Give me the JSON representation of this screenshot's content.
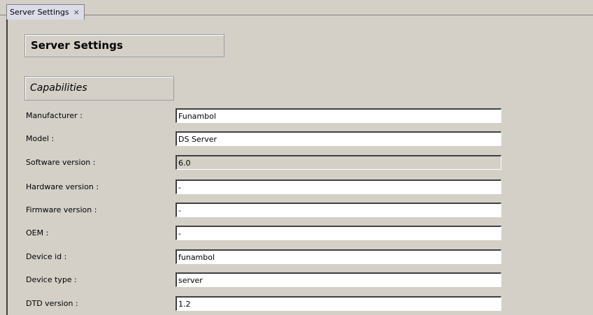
{
  "tab": {
    "label": "Server Settings",
    "close_glyph": "×"
  },
  "page": {
    "title": "Server Settings",
    "section": "Capabilities"
  },
  "fields": [
    {
      "label": "Manufacturer :",
      "value": "Funambol",
      "readonly": false
    },
    {
      "label": "Model :",
      "value": "DS Server",
      "readonly": false
    },
    {
      "label": "Software version :",
      "value": "6.0",
      "readonly": true
    },
    {
      "label": "Hardware version :",
      "value": "-",
      "readonly": false
    },
    {
      "label": "Firmware version :",
      "value": "-",
      "readonly": false
    },
    {
      "label": "OEM :",
      "value": "-",
      "readonly": false
    },
    {
      "label": "Device id :",
      "value": "funambol",
      "readonly": false
    },
    {
      "label": "Device type :",
      "value": "server",
      "readonly": false
    },
    {
      "label": "DTD version :",
      "value": "1.2",
      "readonly": false
    }
  ],
  "colors": {
    "background": "#d4d0c8",
    "tab_background": "#dcdbe9",
    "input_background": "#ffffff"
  }
}
